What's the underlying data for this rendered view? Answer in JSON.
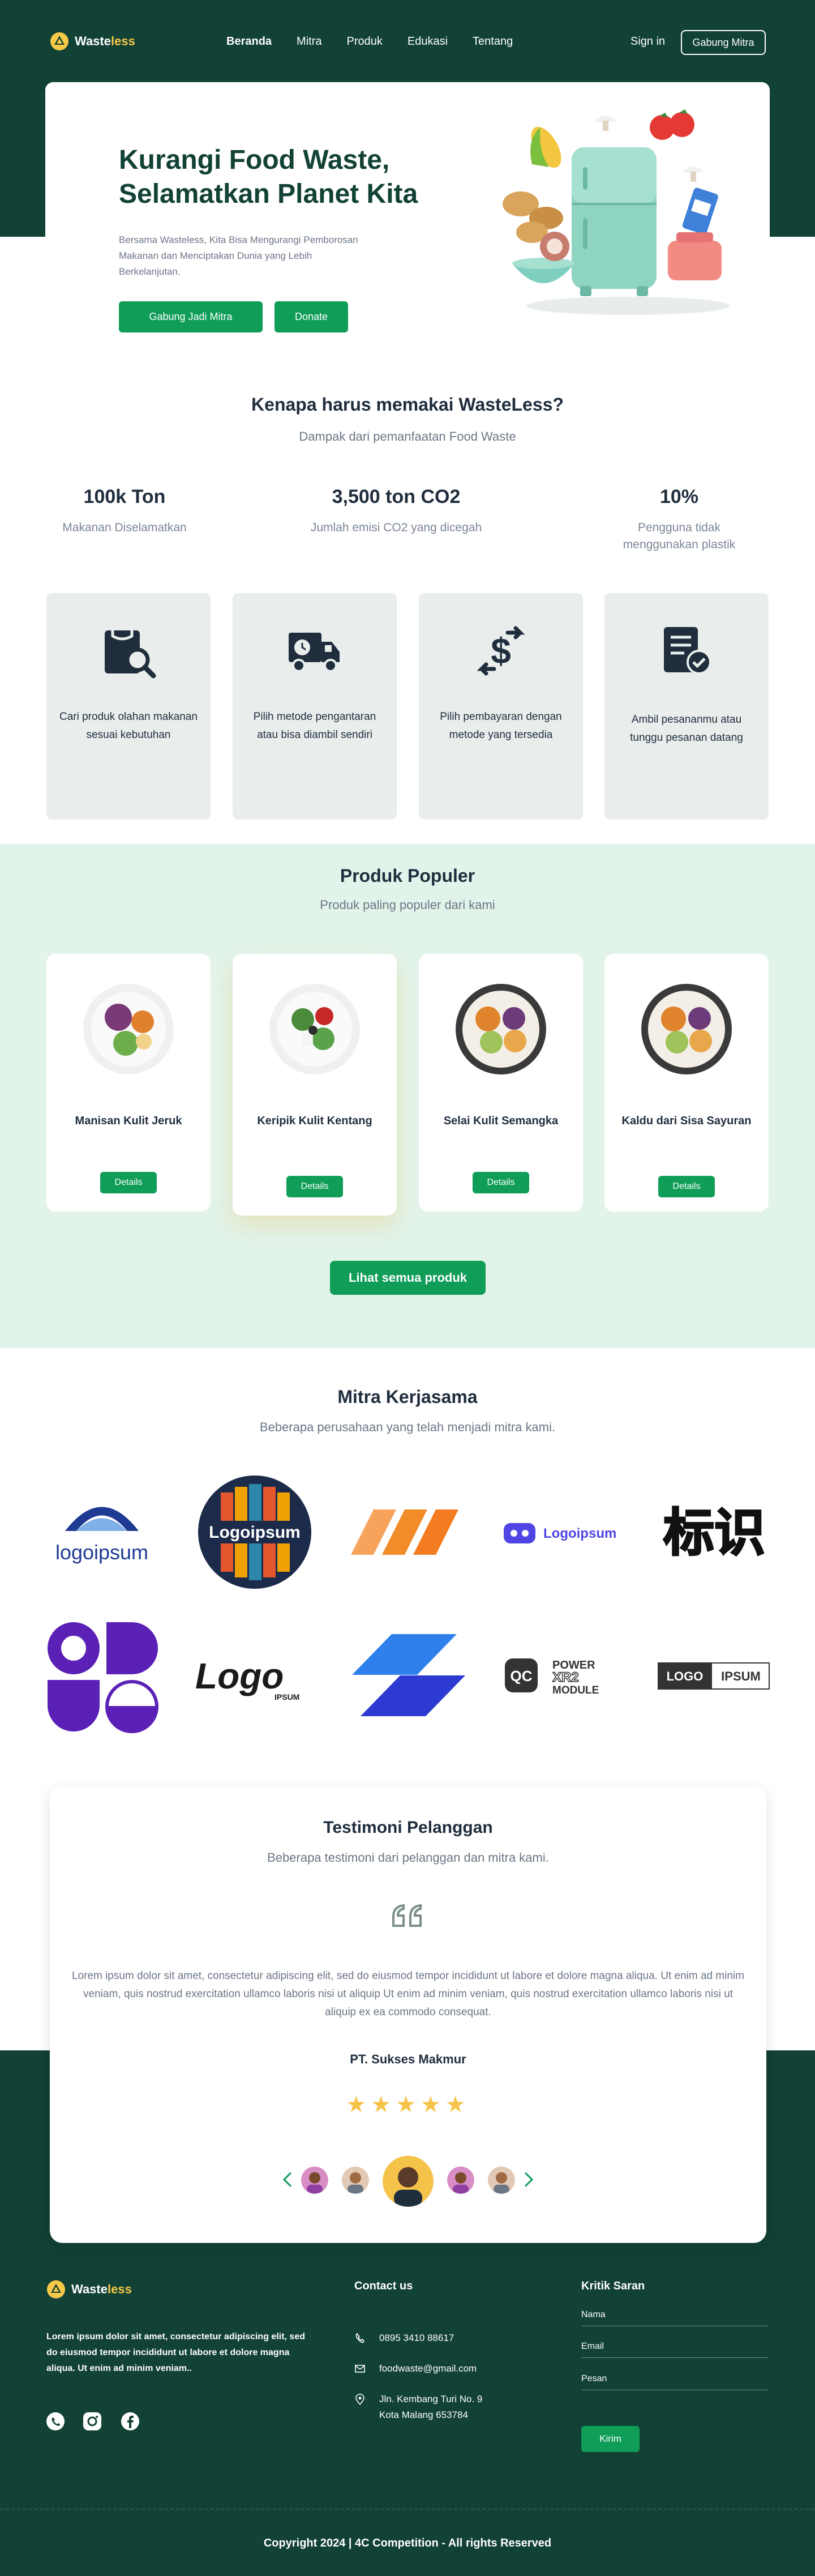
{
  "brand": {
    "name_part1": "Waste",
    "name_part2": "less",
    "accent": "#f7c948",
    "dark_green": "#124135",
    "button_green": "#0f9d58"
  },
  "nav": {
    "links": [
      "Beranda",
      "Mitra",
      "Produk",
      "Edukasi",
      "Tentang"
    ],
    "signin": "Sign in",
    "join": "Gabung Mitra"
  },
  "hero": {
    "title_line1": "Kurangi Food Waste,",
    "title_line2": "Selamatkan Planet Kita",
    "desc": "Bersama Wasteless, Kita Bisa Mengurangi Pemborosan Makanan dan Menciptakan Dunia yang Lebih Berkelanjutan.",
    "btn_partner": "Gabung Jadi Mitra",
    "btn_donate": "Donate"
  },
  "why": {
    "title": "Kenapa harus memakai WasteLess?",
    "subtitle": "Dampak dari pemanfaatan Food Waste",
    "stats": [
      {
        "num": "100k Ton",
        "label": "Makanan Diselamatkan"
      },
      {
        "num": "3,500 ton CO2",
        "label": "Jumlah emisi CO2 yang dicegah"
      },
      {
        "num": "10%",
        "label": "Pengguna tidak menggunakan plastik"
      }
    ],
    "features": [
      {
        "icon": "search-bag-icon",
        "text": "Cari produk olahan makanan sesuai kebutuhan"
      },
      {
        "icon": "delivery-truck-icon",
        "text": "Pilih metode pengantaran atau bisa diambil sendiri"
      },
      {
        "icon": "payment-exchange-icon",
        "text": "Pilih pembayaran dengan metode yang tersedia"
      },
      {
        "icon": "order-check-icon",
        "text": "Ambil pesananmu atau tunggu pesanan datang"
      }
    ]
  },
  "products": {
    "title": "Produk Populer",
    "subtitle": "Produk paling populer dari kami",
    "items": [
      {
        "name": "Manisan Kulit Jeruk",
        "btn": "Details"
      },
      {
        "name": "Keripik Kulit Kentang",
        "btn": "Details"
      },
      {
        "name": "Selai Kulit Semangka",
        "btn": "Details"
      },
      {
        "name": "Kaldu dari Sisa Sayuran",
        "btn": "Details"
      }
    ],
    "all_btn": "Lihat semua produk"
  },
  "partners": {
    "title": "Mitra Kerjasama",
    "subtitle": "Beberapa perusahaan yang telah menjadi mitra kami.",
    "logo_texts": [
      "logoipsum",
      "Logoipsum",
      "Logoipsum",
      "标识",
      "Logo",
      "IPSUM",
      "QC",
      "POWER",
      "XR2",
      "MODULE",
      "LOGO",
      "IPSUM"
    ]
  },
  "testimonial": {
    "title": "Testimoni Pelanggan",
    "subtitle": "Beberapa testimoni dari pelanggan dan mitra kami.",
    "body": "Lorem ipsum dolor sit amet, consectetur adipiscing elit, sed do eiusmod tempor incididunt ut labore et dolore magna aliqua. Ut enim ad minim veniam, quis nostrud exercitation ullamco laboris nisi ut aliquip  Ut enim ad minim veniam, quis nostrud exercitation ullamco laboris nisi ut aliquip ex ea commodo consequat.",
    "name": "PT. Sukses Makmur",
    "stars": "★★★★★",
    "rating": 5
  },
  "footer": {
    "desc": "Lorem ipsum dolor sit amet, consectetur adipiscing elit, sed do eiusmod tempor incididunt ut labore et dolore magna aliqua. Ut enim ad minim veniam..",
    "contact_title": "Contact us",
    "phone": "0895 3410 88617",
    "email": "foodwaste@gmail.com",
    "address_line1": "Jln. Kembang Turi No. 9",
    "address_line2": "Kota Malang 653784",
    "kritik_title": "Kritik Saran",
    "field_name": "Nama",
    "field_email": "Email",
    "field_message": "Pesan",
    "submit": "Kirim",
    "copyright": "Copyright 2024 | 4C Competition - All rights Reserved"
  }
}
